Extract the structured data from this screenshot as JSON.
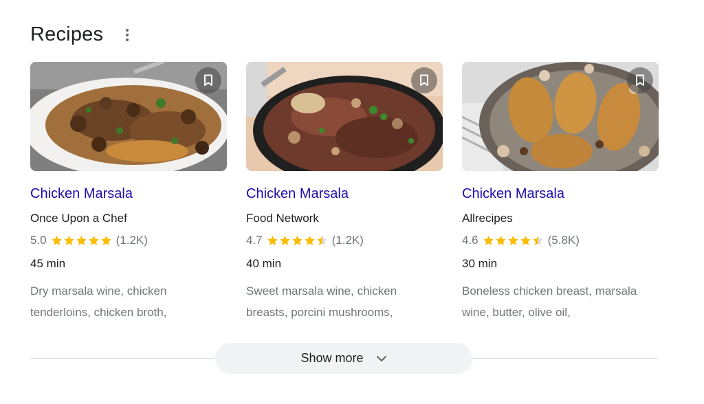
{
  "section": {
    "title": "Recipes",
    "more_icon": "more-vert-icon"
  },
  "cards": [
    {
      "title": "Chicken Marsala",
      "source": "Once Upon a Chef",
      "rating": "5.0",
      "stars": 5.0,
      "reviews": "(1.2K)",
      "time": "45 min",
      "ingredients": "Dry marsala wine, chicken tenderloins, chicken broth,"
    },
    {
      "title": "Chicken Marsala",
      "source": "Food Network",
      "rating": "4.7",
      "stars": 4.7,
      "reviews": "(1.2K)",
      "time": "40 min",
      "ingredients": "Sweet marsala wine, chicken breasts, porcini mushrooms,"
    },
    {
      "title": "Chicken Marsala",
      "source": "Allrecipes",
      "rating": "4.6",
      "stars": 4.6,
      "reviews": "(5.8K)",
      "time": "30 min",
      "ingredients": "Boneless chicken breast, marsala wine, butter, olive oil,"
    }
  ],
  "show_more": {
    "label": "Show more",
    "icon": "chevron-down-icon"
  },
  "colors": {
    "link": "#1a0dab",
    "star": "#fbbc04",
    "star_empty": "#dadce0",
    "muted": "#70757a"
  }
}
